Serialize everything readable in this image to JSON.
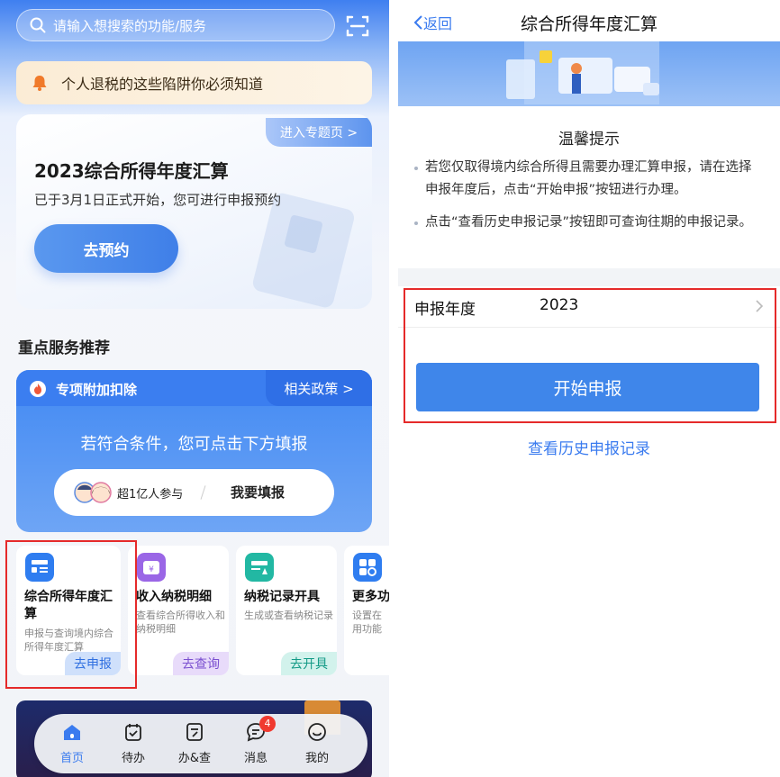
{
  "left": {
    "search": {
      "placeholder": "请输入想搜索的功能/服务"
    },
    "notice": {
      "text": "个人退税的这些陷阱你必须知道"
    },
    "promo": {
      "topic_link": "进入专题页 >",
      "title": "2023综合所得年度汇算",
      "subtitle": "已于3月1日正式开始，您可进行申报预约",
      "button": "去预约"
    },
    "section_title": "重点服务推荐",
    "special": {
      "title": "专项附加扣除",
      "policy_link": "相关政策 >",
      "description": "若符合条件，您可点击下方填报",
      "participants": "超1亿人参与",
      "fill_button": "我要填报"
    },
    "services": [
      {
        "name_line1": "综合所得年度汇",
        "name_line2": "算",
        "desc_line1": "申报与查询境内综合",
        "desc_line2": "所得年度汇算",
        "button": "去申报",
        "color": "#2f7df0"
      },
      {
        "name_line1": "收入纳税明细",
        "name_line2": "",
        "desc_line1": "查看综合所得收入和",
        "desc_line2": "纳税明细",
        "button": "去查询",
        "color": "#9a66e6"
      },
      {
        "name_line1": "纳税记录开具",
        "name_line2": "",
        "desc_line1": "生成或查看纳税记录",
        "desc_line2": "",
        "button": "去开具",
        "color": "#22b8a3"
      },
      {
        "name_line1": "更多功",
        "name_line2": "",
        "desc_line1": "设置在",
        "desc_line2": "用功能",
        "button": "",
        "color": "#2f7df0"
      }
    ],
    "tabs": [
      {
        "label": "首页",
        "icon": "home-icon",
        "active": true
      },
      {
        "label": "待办",
        "icon": "todo-icon",
        "active": false
      },
      {
        "label": "办&查",
        "icon": "handle-query-icon",
        "active": false
      },
      {
        "label": "消息",
        "icon": "message-icon",
        "active": false,
        "badge": "4"
      },
      {
        "label": "我的",
        "icon": "profile-icon",
        "active": false
      }
    ]
  },
  "right": {
    "back_label": "返回",
    "title": "综合所得年度汇算",
    "tips_title": "温馨提示",
    "tips": [
      "若您仅取得境内综合所得且需要办理汇算申报，请在选择申报年度后，点击“开始申报”按钮进行办理。",
      "点击“查看历史申报记录”按钮即可查询往期的申报记录。"
    ],
    "year_label": "申报年度",
    "year_value": "2023",
    "start_button": "开始申报",
    "history_link": "查看历史申报记录"
  },
  "colors": {
    "accent": "#3a7bef",
    "highlight": "#e52a2a",
    "badge": "#f0392f"
  }
}
